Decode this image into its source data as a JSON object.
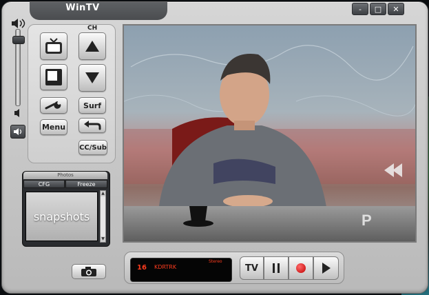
{
  "window": {
    "title": "WinTV",
    "controls": {
      "minimize": "-",
      "maximize": "□",
      "close": "✕"
    }
  },
  "volume": {
    "level": 0.9,
    "icons": {
      "up": "speaker-high-icon",
      "down": "speaker-low-icon",
      "mute": "speaker-icon"
    }
  },
  "controls": {
    "ch_label": "CH",
    "surf_label": "Surf",
    "menu_label": "Menu",
    "ccsub_label": "CC/Sub",
    "icons": {
      "tv": "tv-icon",
      "pip": "picture-in-picture-icon",
      "ch_up": "triangle-up-icon",
      "ch_down": "triangle-down-icon",
      "settings": "wrench-icon",
      "back": "back-arrow-icon"
    }
  },
  "snapshots": {
    "header": "Photos",
    "tabs": [
      "CFG",
      "Freeze"
    ],
    "view_label": "snapshots",
    "camera_icon": "camera-icon"
  },
  "status": {
    "channel": "16",
    "station": "KDRTRK",
    "audio": "Stereo"
  },
  "transport": {
    "tv_label": "TV",
    "icons": {
      "pause": "pause-icon",
      "record": "record-icon",
      "play": "play-icon"
    }
  },
  "colors": {
    "lcd_text": "#ff3c1e",
    "record": "#d00000",
    "chrome_dark": "#4a4c4f"
  }
}
